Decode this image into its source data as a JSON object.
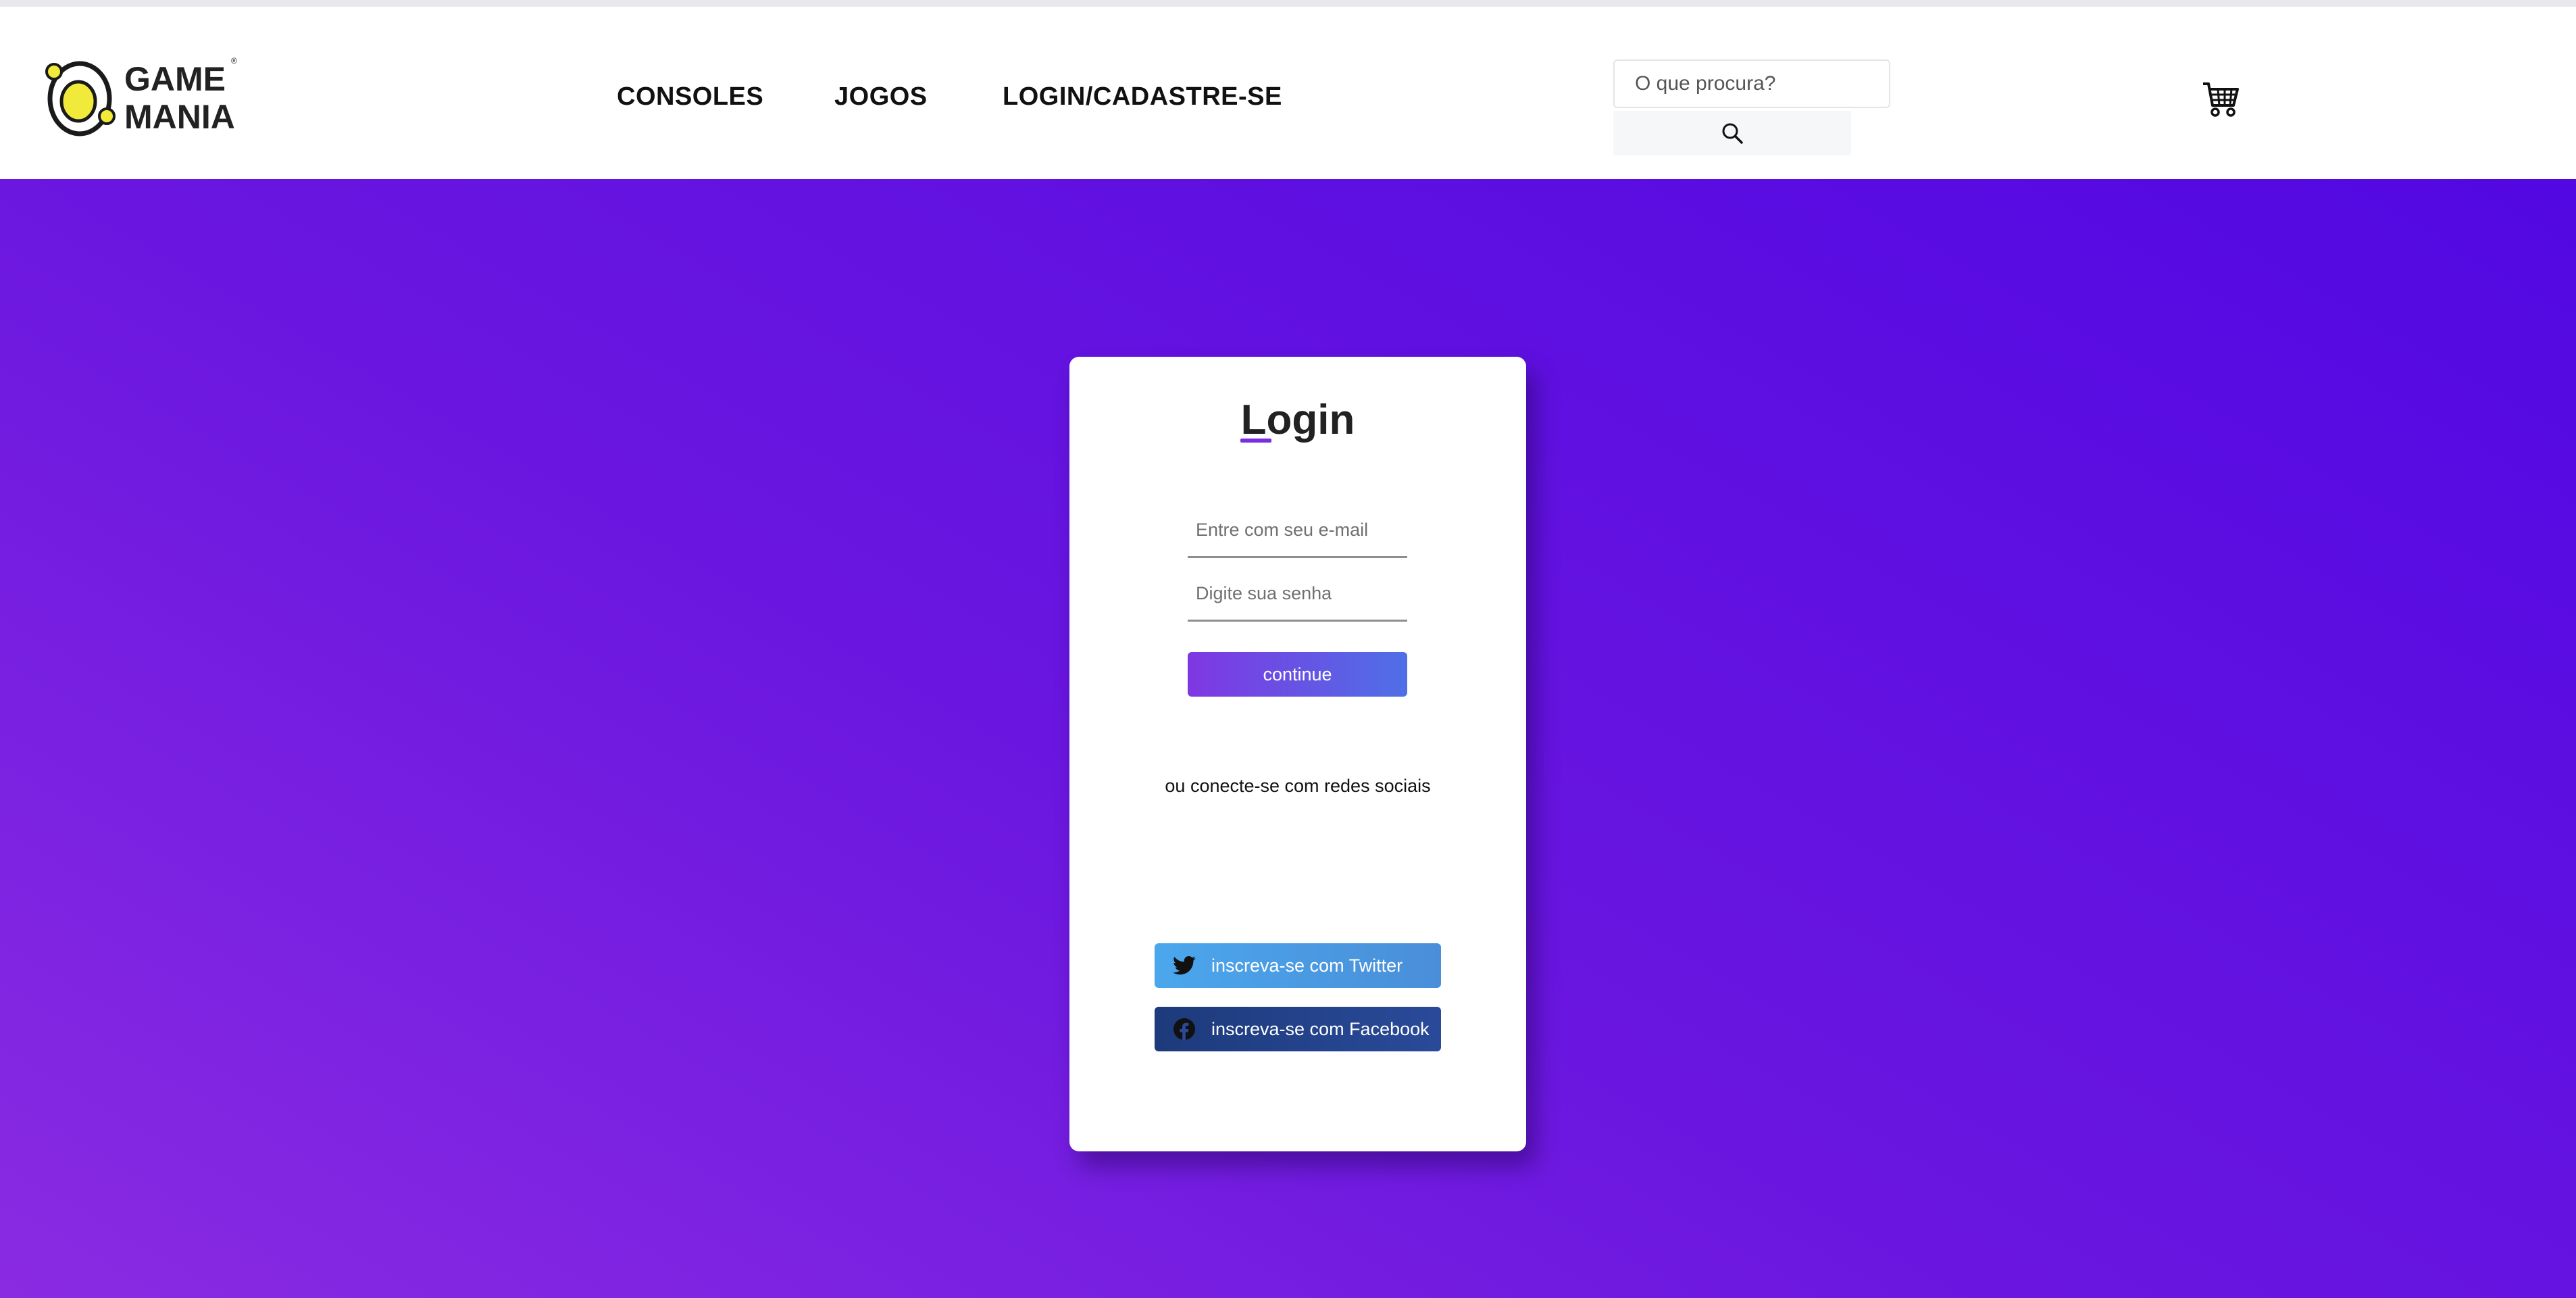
{
  "brand": {
    "line1": "GAME",
    "line2": "MANIA",
    "registered": "®"
  },
  "nav": {
    "items": [
      {
        "label": "CONSOLES"
      },
      {
        "label": "JOGOS"
      },
      {
        "label": "LOGIN/CADASTRE-SE"
      }
    ]
  },
  "search": {
    "placeholder": "O que procura?",
    "icon": "search-icon"
  },
  "cart": {
    "icon": "shopping-cart-icon"
  },
  "login": {
    "title": "Login",
    "email_placeholder": "Entre com seu e-mail",
    "password_placeholder": "Digite sua senha",
    "continue_label": "continue",
    "social_text": "ou conecte-se com redes sociais",
    "twitter_label": "inscreva-se com Twitter",
    "facebook_label": "inscreva-se com Facebook"
  },
  "colors": {
    "background_gradient_start": "#8a2be2",
    "background_gradient_end": "#5208e2",
    "continue_start": "#7f37e3",
    "continue_end": "#4f6fe6",
    "twitter": "#4ba7ec",
    "facebook": "#1d3a7c",
    "logo_accent": "#f2ea3a"
  }
}
